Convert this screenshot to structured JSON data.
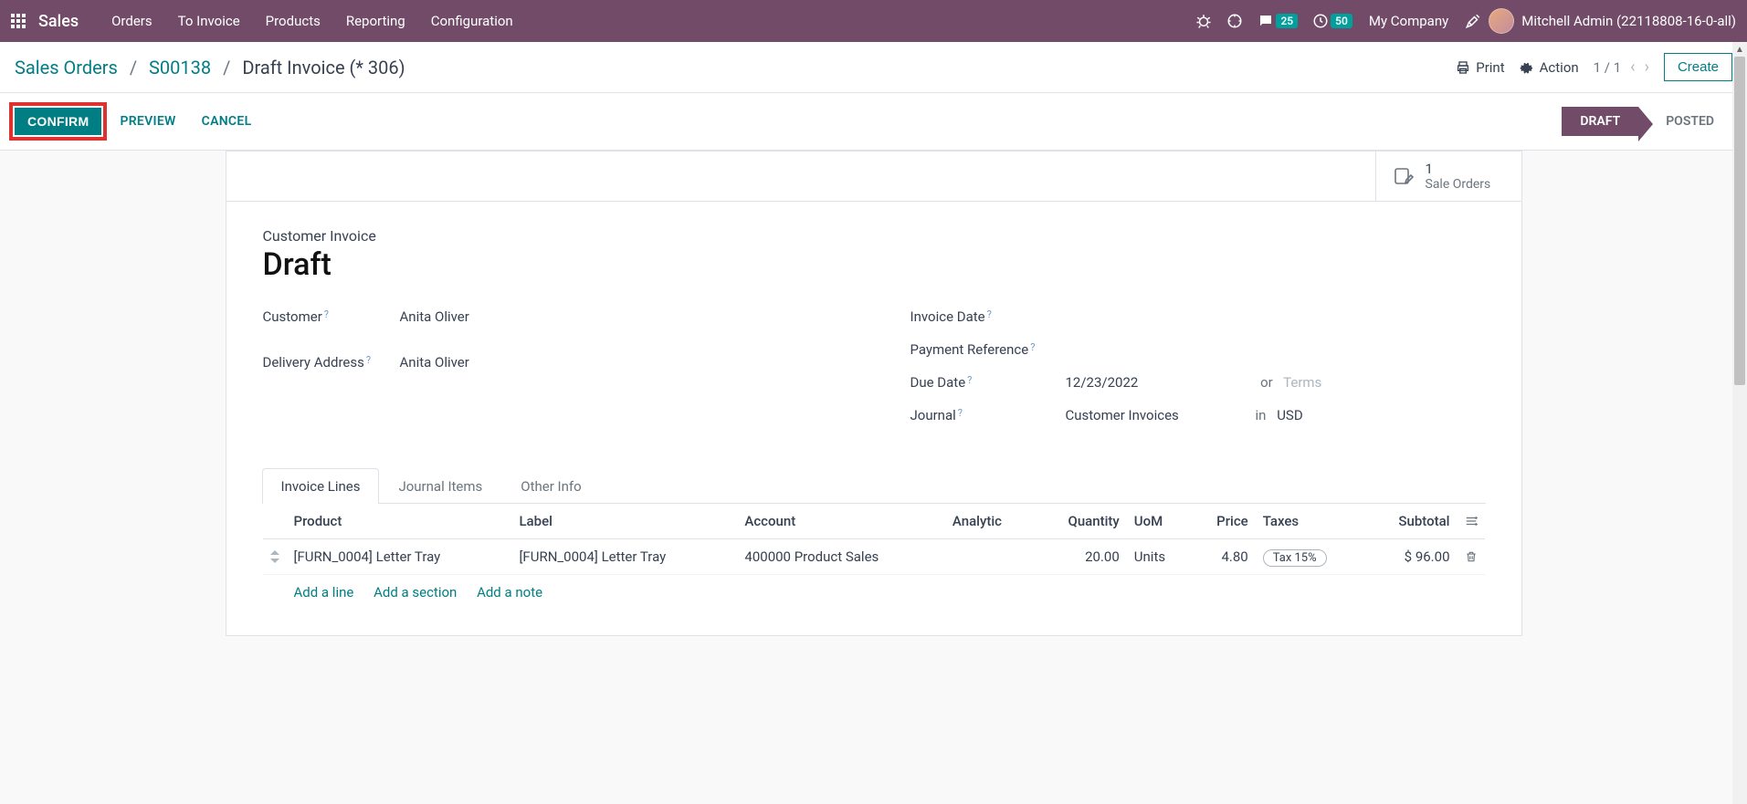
{
  "nav": {
    "brand": "Sales",
    "items": [
      "Orders",
      "To Invoice",
      "Products",
      "Reporting",
      "Configuration"
    ],
    "chat_count": "25",
    "clock_count": "50",
    "company": "My Company",
    "user": "Mitchell Admin (22118808-16-0-all)"
  },
  "breadcrumb": {
    "part1": "Sales Orders",
    "part2": "S00138",
    "current": "Draft Invoice (* 306)"
  },
  "control": {
    "print": "Print",
    "action": "Action",
    "pager": "1 / 1",
    "create": "Create"
  },
  "actions": {
    "confirm": "CONFIRM",
    "preview": "PREVIEW",
    "cancel": "CANCEL",
    "status_active": "DRAFT",
    "status_inactive": "POSTED"
  },
  "btnbox": {
    "count": "1",
    "label": "Sale Orders"
  },
  "doc": {
    "type": "Customer Invoice",
    "title": "Draft"
  },
  "fields": {
    "customer_label": "Customer",
    "customer_value": "Anita Oliver",
    "delivery_label": "Delivery Address",
    "delivery_value": "Anita Oliver",
    "invoice_date_label": "Invoice Date",
    "invoice_date_value": "",
    "payref_label": "Payment Reference",
    "payref_value": "",
    "due_label": "Due Date",
    "due_value": "12/23/2022",
    "due_or": "or",
    "due_terms_placeholder": "Terms",
    "journal_label": "Journal",
    "journal_value": "Customer Invoices",
    "journal_in": "in",
    "journal_currency": "USD"
  },
  "tabs": [
    "Invoice Lines",
    "Journal Items",
    "Other Info"
  ],
  "table": {
    "headers": {
      "product": "Product",
      "label": "Label",
      "account": "Account",
      "analytic": "Analytic",
      "quantity": "Quantity",
      "uom": "UoM",
      "price": "Price",
      "taxes": "Taxes",
      "subtotal": "Subtotal"
    },
    "row": {
      "product": "[FURN_0004] Letter Tray",
      "label": "[FURN_0004] Letter Tray",
      "account": "400000 Product Sales",
      "analytic": "",
      "quantity": "20.00",
      "uom": "Units",
      "price": "4.80",
      "tax": "Tax 15%",
      "subtotal": "$ 96.00"
    },
    "add_line": "Add a line",
    "add_section": "Add a section",
    "add_note": "Add a note"
  }
}
